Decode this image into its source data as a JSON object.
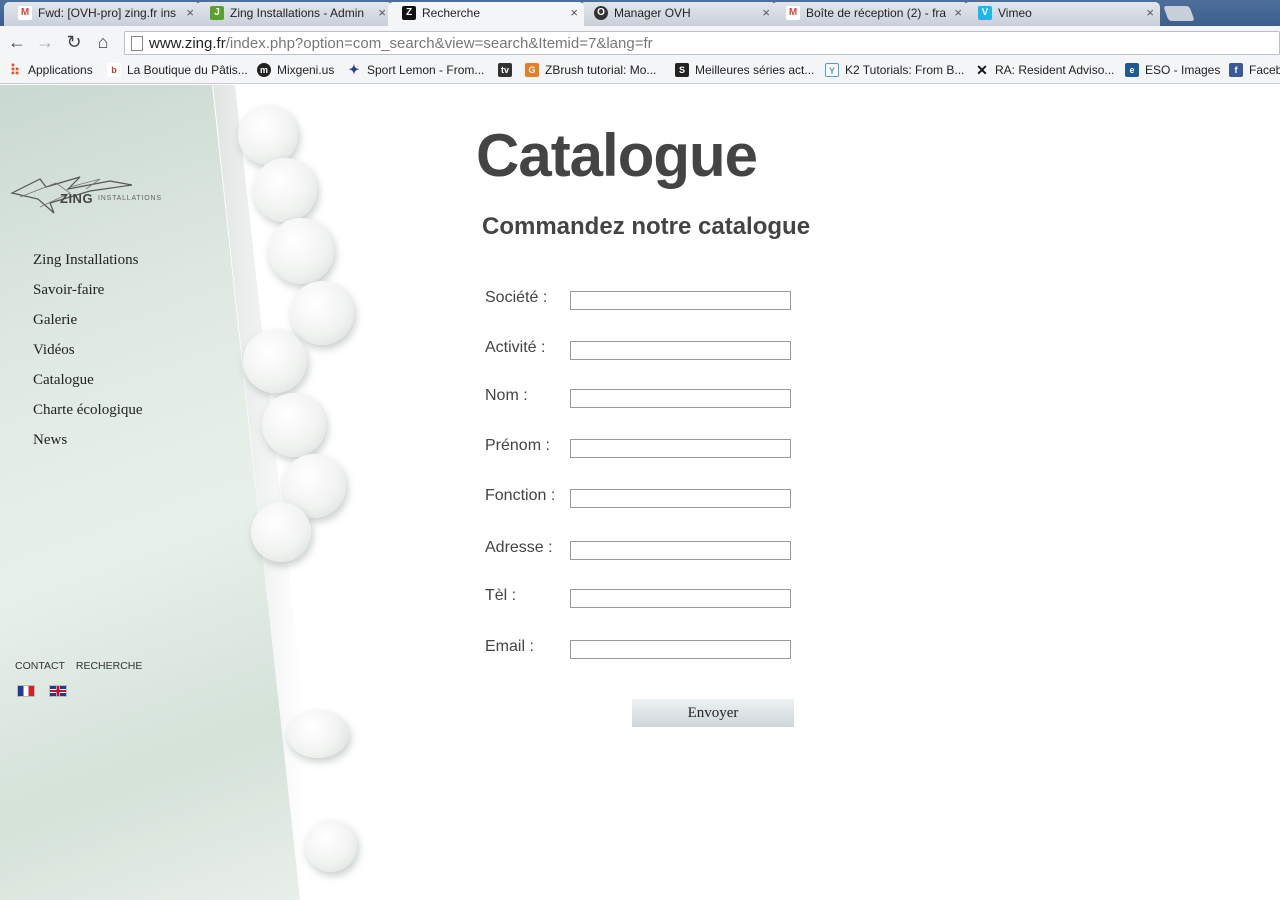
{
  "browser": {
    "tabs": [
      {
        "title": "Fwd: [OVH-pro] zing.fr ins",
        "icon": "gmail-icon",
        "color": "#d14836",
        "glyph": "M"
      },
      {
        "title": "Zing Installations - Admin",
        "icon": "joomla-icon",
        "color": "#5aa02c",
        "glyph": "J"
      },
      {
        "title": "Recherche",
        "icon": "zing-icon",
        "color": "#111111",
        "glyph": "Z"
      },
      {
        "title": "Manager OVH",
        "icon": "ovh-icon",
        "color": "#333333",
        "glyph": "O"
      },
      {
        "title": "Boîte de réception (2) - fra",
        "icon": "gmail-icon",
        "color": "#d14836",
        "glyph": "M"
      },
      {
        "title": "Vimeo",
        "icon": "vimeo-icon",
        "color": "#1ab7ea",
        "glyph": "V"
      }
    ],
    "close_glyph": "×",
    "url_host": "www.zing.fr",
    "url_path": "/index.php?option=com_search&view=search&Itemid=7&lang=fr",
    "bookmarks": [
      {
        "label": "Applications",
        "icon": "apps-grid-icon",
        "color": "#e34c26",
        "glyph": "⠿"
      },
      {
        "label": "La Boutique du Pâtis...",
        "icon": "boutique-icon",
        "color": "#c0392b",
        "glyph": "b"
      },
      {
        "label": "Mixgeni.us",
        "icon": "mixgenius-icon",
        "color": "#222222",
        "glyph": "m"
      },
      {
        "label": "Sport Lemon - From...",
        "icon": "sport-lemon-icon",
        "color": "#2c3e8f",
        "glyph": "✦"
      },
      {
        "label": "",
        "icon": "tv-icon",
        "color": "#333333",
        "glyph": "tv"
      },
      {
        "label": "ZBrush tutorial: Mo...",
        "icon": "zbrush-icon",
        "color": "#e67e22",
        "glyph": "G"
      },
      {
        "label": "Meilleures séries act...",
        "icon": "series-icon",
        "color": "#222222",
        "glyph": "S"
      },
      {
        "label": "K2 Tutorials: From B...",
        "icon": "k2-icon",
        "color": "#4aa3df",
        "glyph": "Y"
      },
      {
        "label": "RA: Resident Adviso...",
        "icon": "ra-icon",
        "color": "#111111",
        "glyph": "✕"
      },
      {
        "label": "ESO - Images",
        "icon": "eso-icon",
        "color": "#1e5a96",
        "glyph": "e"
      },
      {
        "label": "Faceb",
        "icon": "facebook-icon",
        "color": "#3b5998",
        "glyph": "f"
      }
    ]
  },
  "site": {
    "logo_text": "ZING",
    "logo_sub": "INSTALLATIONS",
    "nav": [
      "Zing Installations",
      "Savoir-faire",
      "Galerie",
      "Vidéos",
      "Catalogue",
      "Charte écologique",
      "News"
    ],
    "footer_links": [
      "CONTACT",
      "RECHERCHE"
    ],
    "languages": [
      "fr",
      "en"
    ]
  },
  "main": {
    "title": "Catalogue",
    "subtitle": "Commandez notre catalogue",
    "fields": [
      {
        "label": "Société :",
        "value": ""
      },
      {
        "label": "Activité :",
        "value": ""
      },
      {
        "label": "Nom :",
        "value": ""
      },
      {
        "label": "Prénom :",
        "value": ""
      },
      {
        "label": "Fonction :",
        "value": ""
      },
      {
        "label": "Adresse :",
        "value": ""
      },
      {
        "label": "Tèl :",
        "value": ""
      },
      {
        "label": "Email :",
        "value": ""
      }
    ],
    "submit_label": "Envoyer"
  }
}
